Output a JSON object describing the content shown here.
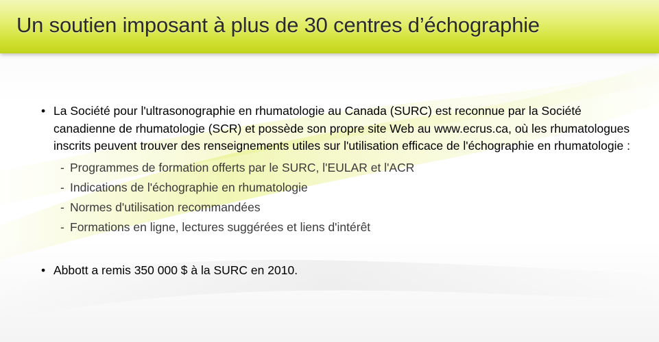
{
  "slide": {
    "title": "Un soutien imposant à plus de 30 centres d’échographie",
    "bullets": [
      {
        "marker": "•",
        "text": "La Société pour l'ultrasonographie en rhumatologie au Canada (SURC) est reconnue par la Société canadienne de rhumatologie (SCR) et possède son propre site Web au www.ecrus.ca, où les rhumatologues inscrits peuvent trouver des renseignements utiles sur l'utilisation efficace de l'échographie en rhumatologie :",
        "sub_items": [
          {
            "marker": "-",
            "text": "Programmes de formation offerts par le SURC, l'EULAR et l'ACR"
          },
          {
            "marker": "-",
            "text": "Indications de l'échographie en rhumatologie"
          },
          {
            "marker": "-",
            "text": "Normes d'utilisation recommandées"
          },
          {
            "marker": "-",
            "text": "Formations en ligne, lectures suggérées et liens d'intérêt"
          }
        ]
      },
      {
        "marker": "•",
        "text": "Abbott a remis 350 000 $ à la SURC en 2010."
      }
    ]
  },
  "colors": {
    "title_bar_top": "#f2f7b8",
    "title_bar_bottom": "#c2d31c",
    "swoosh": "#e8f08a",
    "title_text": "#2b2b2b",
    "body_text": "#000000",
    "sub_text": "#3a3a3a"
  }
}
